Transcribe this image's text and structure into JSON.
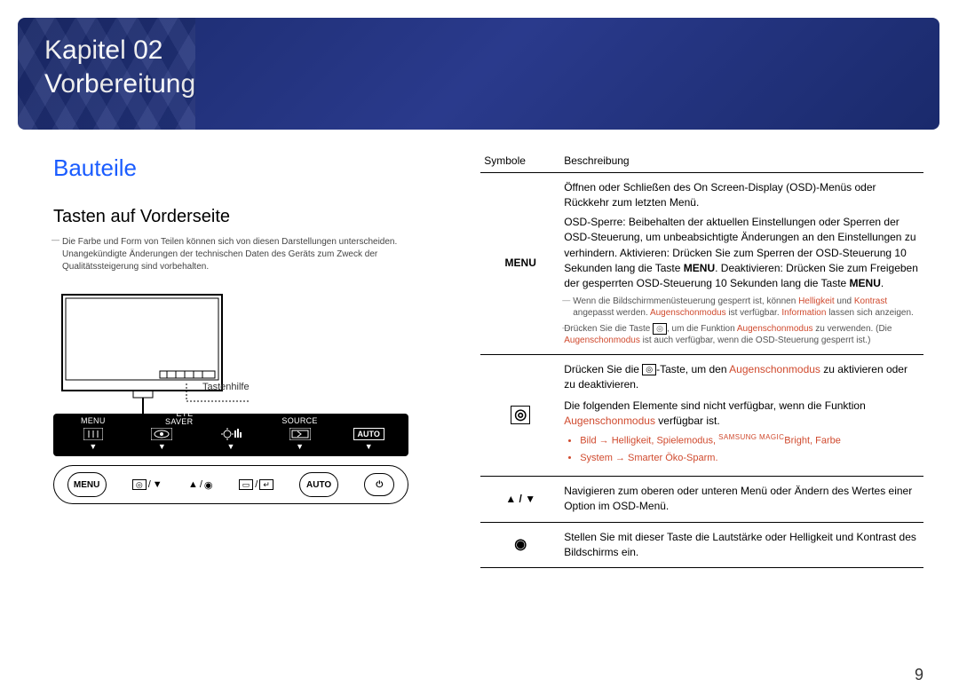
{
  "banner": {
    "chapter": "Kapitel 02",
    "title": "Vorbereitung"
  },
  "left": {
    "section_title": "Bauteile",
    "subsection_title": "Tasten auf Vorderseite",
    "note": "Die Farbe und Form von Teilen können sich von diesen Darstellungen unterscheiden. Unangekündigte Änderungen der technischen Daten des Geräts zum Zweck der Qualitätssteigerung sind vorbehalten.",
    "tastenhilfe_label": "Tastenhilfe",
    "osd": {
      "menu_label": "MENU",
      "eye_saver_line1": "EYE",
      "eye_saver_line2": "SAVER",
      "source_label": "SOURCE",
      "auto_label": "AUTO"
    },
    "buttons": {
      "menu": "MENU",
      "auto": "AUTO"
    }
  },
  "right": {
    "headers": {
      "symbol": "Symbole",
      "description": "Beschreibung"
    },
    "rows": {
      "menu": {
        "symbol": "MENU",
        "desc_p1": "Öffnen oder Schließen des On Screen-Display (OSD)-Menüs oder Rückkehr zum letzten Menü.",
        "desc_p2a": "OSD-Sperre: Beibehalten der aktuellen Einstellungen oder Sperren der OSD-Steuerung, um unbeabsichtigte Änderungen an den Einstellungen zu verhindern. Aktivieren: Drücken Sie zum Sperren der OSD-Steuerung 10 Sekunden lang die Taste ",
        "desc_p2_menu1": "MENU",
        "desc_p2b": ". Deaktivieren: Drücken Sie zum Freigeben der gesperrten OSD-Steuerung 10 Sekunden lang die Taste ",
        "desc_p2_menu2": "MENU",
        "desc_p2c": ".",
        "note1a": "Wenn die Bildschirmmenüsteuerung gesperrt ist, können ",
        "note1_helligkeit": "Helligkeit",
        "note1b": " und ",
        "note1_kontrast": "Kontrast",
        "note1c": " angepasst werden. ",
        "note1_augen": "Augenschonmodus",
        "note1d": " ist verfügbar. ",
        "note1_info": "Information",
        "note1e": " lassen sich anzeigen.",
        "note2a": "Drücken Sie die Taste ",
        "note2b": ", um die Funktion ",
        "note2_augen": "Augenschonmodus",
        "note2c": " zu verwenden. (Die ",
        "note2_augen2": "Augenschonmodus",
        "note2d": " ist auch verfügbar, wenn die OSD-Steuerung gesperrt ist.)"
      },
      "eye": {
        "desc_p1a": "Drücken Sie die ",
        "desc_p1b": "-Taste, um den ",
        "desc_p1_augen": "Augenschonmodus",
        "desc_p1c": " zu aktivieren oder zu deaktivieren.",
        "desc_p2a": "Die folgenden Elemente sind nicht verfügbar, wenn die Funktion ",
        "desc_p2_augen": "Augenschonmodus",
        "desc_p2b": " verfügbar ist.",
        "bullet1_a": "Bild",
        "bullet1_b": "Helligkeit",
        "bullet1_c": "Spielemodus",
        "bullet1_d": "Bright",
        "bullet1_e": "Farbe",
        "bullet1_magic": "SAMSUNG MAGIC",
        "bullet2_a": "System",
        "bullet2_b": "Smarter Öko-Sparm."
      },
      "nav": {
        "symbol": "▲ / ▼",
        "desc": "Navigieren zum oberen oder unteren Menü oder Ändern des Wertes einer Option im OSD-Menü."
      },
      "dial": {
        "symbol": "◉",
        "desc": "Stellen Sie mit dieser Taste die Lautstärke oder Helligkeit und Kontrast des Bildschirms ein."
      }
    }
  },
  "page_number": "9"
}
